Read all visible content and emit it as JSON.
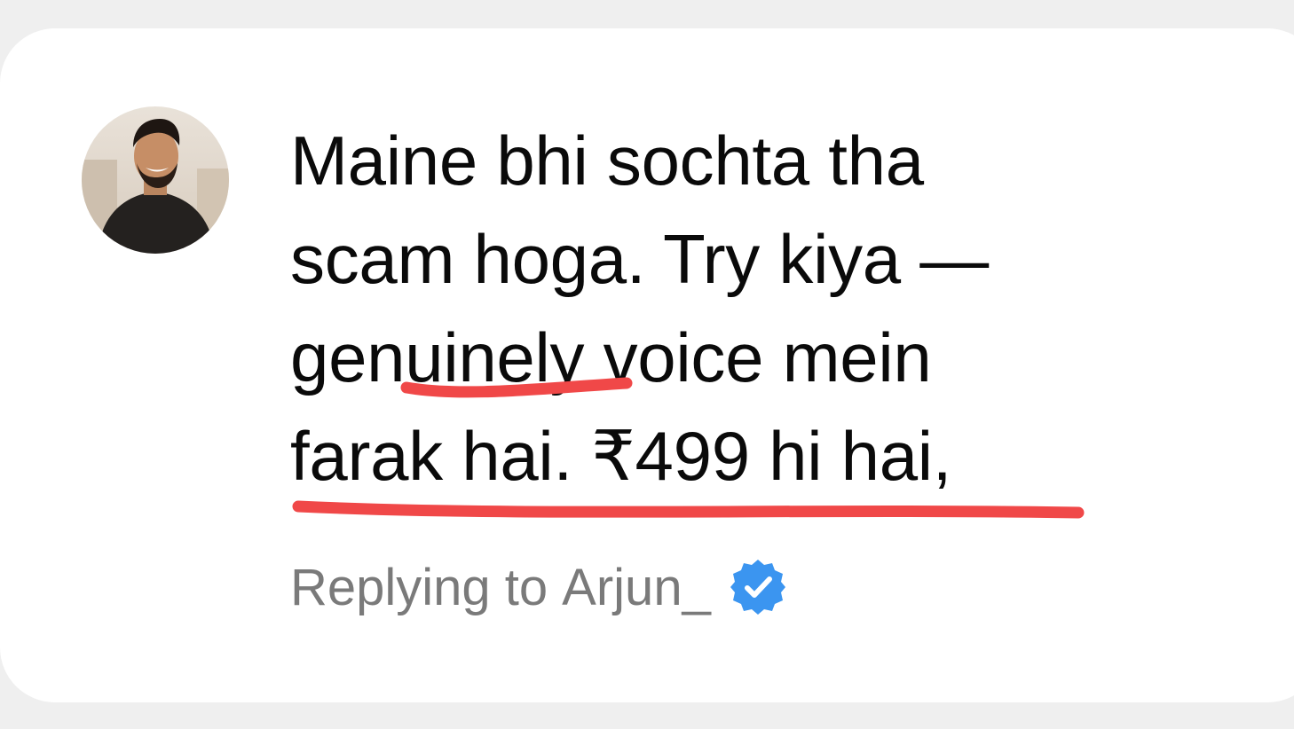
{
  "comment": {
    "lines": [
      "Maine bhi sochta tha",
      "scam hoga. Try kiya —",
      "genuinely voice mein",
      "farak hai. ₹499 hi hai,"
    ],
    "highlight_color": "#f04848"
  },
  "reply": {
    "label": "Replying to",
    "username": "Arjun_",
    "verified": true,
    "verified_color": "#3b95f0"
  },
  "avatar": {
    "icon": "user-avatar-photo"
  }
}
